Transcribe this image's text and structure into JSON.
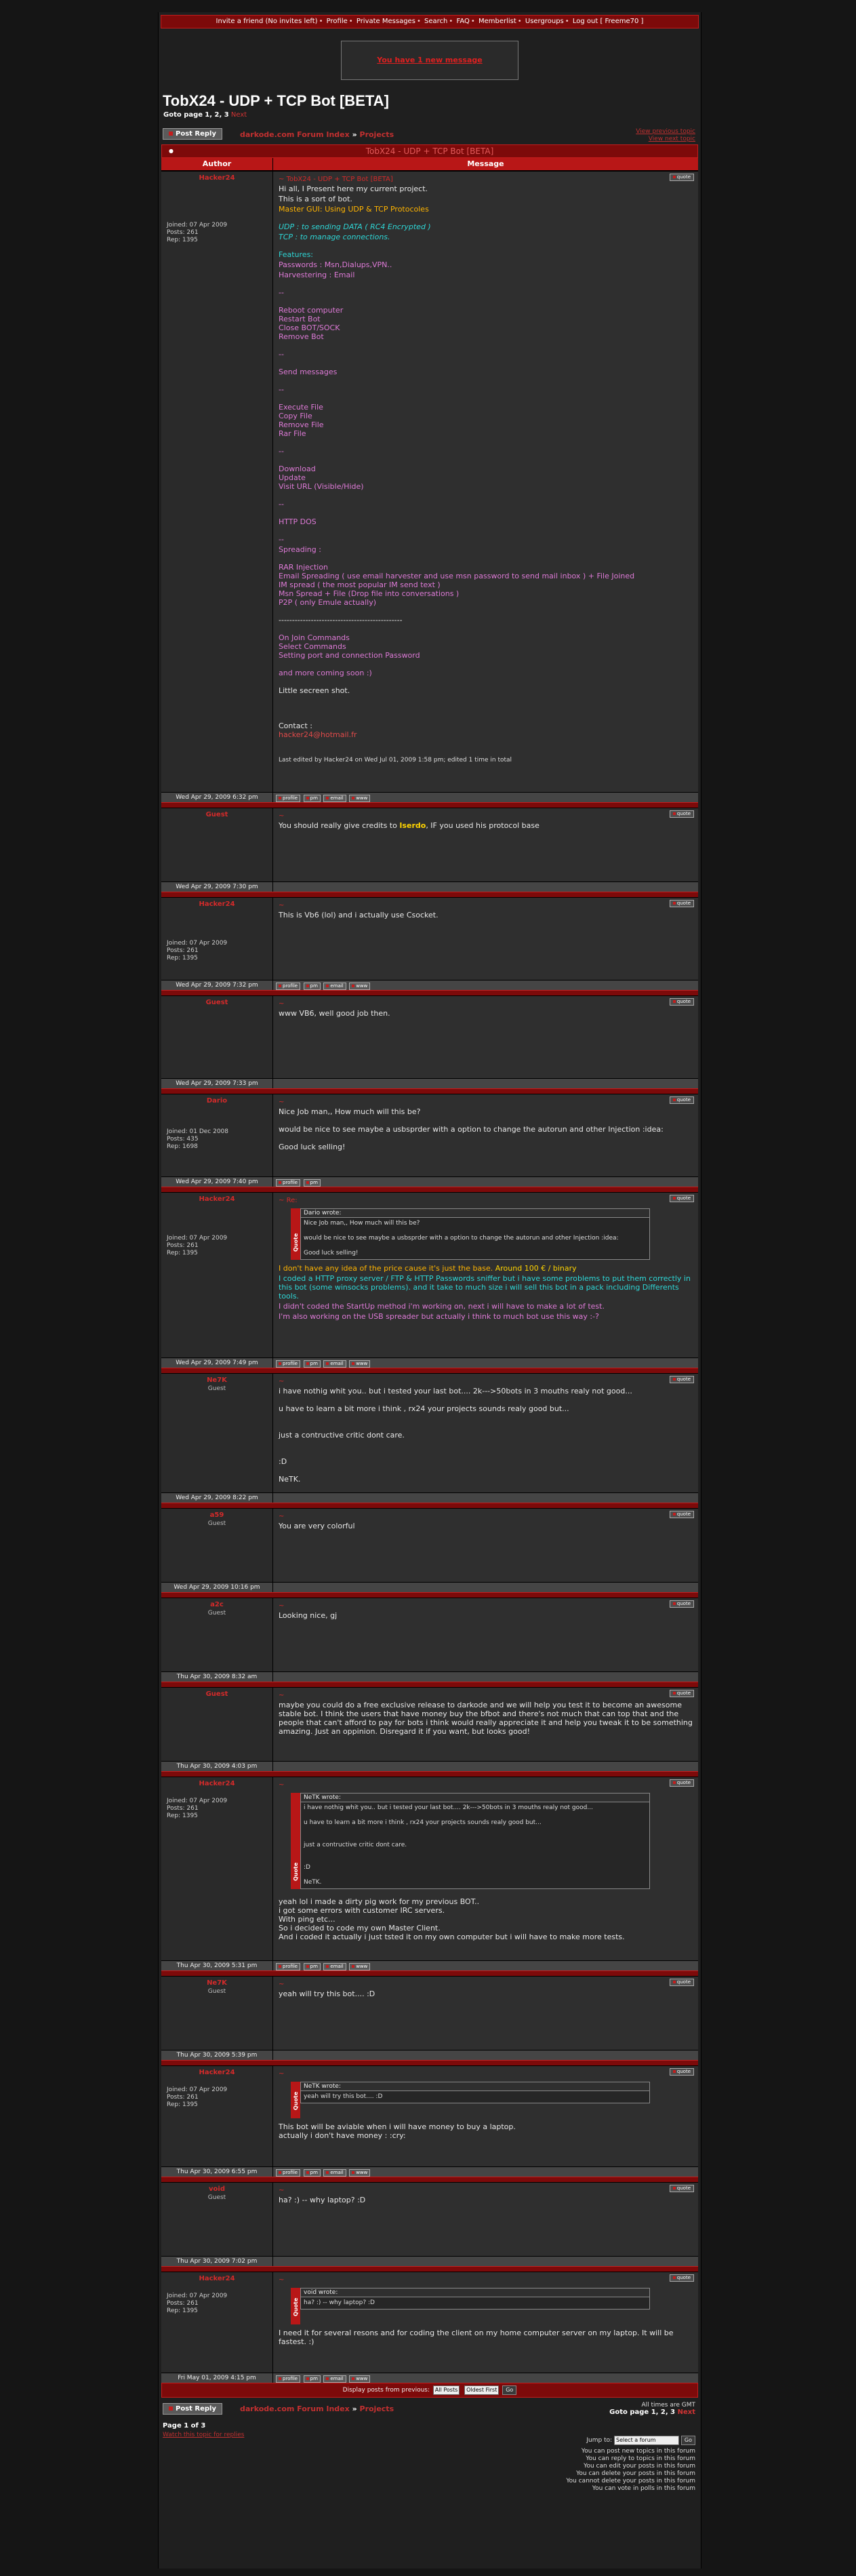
{
  "topnav": {
    "items": [
      "Invite a friend (No invites left)",
      "Profile",
      "Private Messages",
      "Search",
      "FAQ",
      "Memberlist",
      "Usergroups",
      "Log out [ Freeme70 ]"
    ]
  },
  "pm_notice": "You have 1 new message",
  "thread": {
    "title": "TobX24 - UDP + TCP Bot [BETA]",
    "goto_label": "Goto page",
    "goto_pages": "1, 2, 3",
    "goto_next": "Next",
    "post_reply": "Post Reply",
    "crumb_forum_index": "darkode.com Forum Index",
    "crumb_arrow": "»",
    "crumb_projects": "Projects",
    "view_prev": "View previous topic",
    "view_next": "View next topic",
    "table_title": "TobX24 - UDP + TCP Bot [BETA]",
    "col_author": "Author",
    "col_message": "Message"
  },
  "buttons": {
    "quote": "quote",
    "profile": "profile",
    "pm": "pm",
    "email": "email",
    "www": "www"
  },
  "posts": {
    "p1": {
      "author": "Hacker24",
      "joined": "Joined: 07 Apr 2009",
      "posts": "Posts: 261",
      "rep": "Rep: 1395",
      "subject": "TobX24 - UDP + TCP Bot [BETA]",
      "date": "Wed Apr 29, 2009 6:32 pm",
      "edit": "Last edited by Hacker24 on Wed Jul 01, 2009 1:58 pm; edited 1 time in total",
      "l1": "Hi all, I Present here my current project.",
      "l2": "This is a sort of bot.",
      "l3": "Master GUI: Using UDP & TCP Protocoles",
      "l4": "UDP : to sending DATA ( RC4 Encrypted )",
      "l5": "TCP : to manage connections.",
      "l6": "Features:",
      "l7": "Passwords : Msn,Dialups,VPN..",
      "l8": "Harvestering : Email",
      "d": "--",
      "l9": "Reboot computer\nRestart Bot\nClose BOT/SOCK\nRemove Bot",
      "l10": "Send messages",
      "l11": "Execute File\nCopy File\nRemove File\nRar File",
      "l12": "Download\nUpdate\nVisit URL (Visible/Hide)",
      "l13": "HTTP DOS",
      "l14": "Spreading :",
      "l15": "RAR Injection\nEmail Spreading ( use email harvester and use msn password to send mail inbox ) + File Joined\nIM spread ( the most popular IM send text )\nMsn Spread + File (Drop file into conversations )\nP2P ( only Emule actually)",
      "l16": "----------------------------------------------",
      "l17": "On Join Commands\nSelect Commands\nSetting port and connection Password",
      "l18": "and more coming soon :)",
      "l19": "Little secreen shot.",
      "contact_label": "Contact :",
      "contact": "hacker24@hotmail.fr"
    },
    "p2": {
      "author": "Guest",
      "date": "Wed Apr 29, 2009 7:30 pm",
      "t1": "You should really give credits to ",
      "t2": "Iserdo",
      "t3": ", IF you used his protocol base"
    },
    "p3": {
      "author": "Hacker24",
      "joined": "Joined: 07 Apr 2009",
      "posts": "Posts: 261",
      "rep": "Rep: 1395",
      "date": "Wed Apr 29, 2009 7:32 pm",
      "t": "This is Vb6 (lol) and i actually use Csocket."
    },
    "p4": {
      "author": "Guest",
      "date": "Wed Apr 29, 2009 7:33 pm",
      "t": "www VB6, well good job then."
    },
    "p5": {
      "author": "Dario",
      "joined": "Joined: 01 Dec 2008",
      "posts": "Posts: 435",
      "rep": "Rep: 1698",
      "date": "Wed Apr 29, 2009 7:40 pm",
      "t": "Nice Job man,, How much will this be?\n\nwould be nice to see maybe a usbsprder with a option to change the autorun and other Injection :idea:\n\nGood luck selling!"
    },
    "p6": {
      "author": "Hacker24",
      "joined": "Joined: 07 Apr 2009",
      "posts": "Posts: 261",
      "rep": "Rep: 1395",
      "date": "Wed Apr 29, 2009 7:49 pm",
      "subject": "Re:",
      "q_who": "Dario wrote:",
      "q_text": "Nice Job man,, How much will this be?\n\nwould be nice to see maybe a usbsprder with a option to change the autorun and other Injection :idea:\n\nGood luck selling!",
      "t1": "I don't have any idea of the price cause it's just the base. ",
      "t1b": "Around 100 € / binary",
      "t2": "I coded a HTTP proxy server / FTP & HTTP Passwords sniffer but i have some problems to put them correctly in this bot (some winsocks problems). and it take to much size i will sell this bot in a pack including Differents tools.",
      "t3": "I didn't coded the StartUp method i'm working on, next i will have to make a lot of test.",
      "t4": "I'm also working on the USB spreader but actually i think to much bot use this way :-?"
    },
    "p7": {
      "author": "Ne7K",
      "rank": "Guest",
      "date": "Wed Apr 29, 2009 8:22 pm",
      "t": "i have nothig whit you.. but i tested your last bot.... 2k--->50bots in 3 mouths realy not good...\n\nu have to learn a bit more i think , rx24 your projects sounds realy good but...\n\n\njust a contructive critic dont care.\n\n\n:D\n\nNeTK."
    },
    "p8": {
      "author": "a59",
      "rank": "Guest",
      "date": "Wed Apr 29, 2009 10:16 pm",
      "t": "You are very colorful"
    },
    "p9": {
      "author": "a2c",
      "rank": "Guest",
      "date": "Thu Apr 30, 2009 8:32 am",
      "t": "Looking nice, gj"
    },
    "p10": {
      "author": "Guest",
      "date": "Thu Apr 30, 2009 4:03 pm",
      "t": "maybe you could do a free exclusive release to darkode and we will help you test it to become an awesome stable bot. I think the users that have money buy the bfbot and there's not much that can top that and the people that can't afford to pay for bots i think would really appreciate it and help you tweak it to be something amazing. Just an oppinion. Disregard it if you want, but looks good!"
    },
    "p11": {
      "author": "Hacker24",
      "joined": "Joined: 07 Apr 2009",
      "posts": "Posts: 261",
      "rep": "Rep: 1395",
      "date": "Thu Apr 30, 2009 5:31 pm",
      "q_who": "NeTK wrote:",
      "q_text": "i have nothig whit you.. but i tested your last bot.... 2k--->50bots in 3 mouths realy not good...\n\nu have to learn a bit more i think , rx24 your projects sounds realy good but...\n\n\njust a contructive critic dont care.\n\n\n:D\n\nNeTK.",
      "t": "yeah lol i made a dirty pig work for my previous BOT..\ni got some errors with customer IRC servers.\nWith ping etc...\nSo i decided to code my own Master Client.\nAnd i coded it actually i just tsted it on my own computer but i will have to make more tests."
    },
    "p12": {
      "author": "Ne7K",
      "rank": "Guest",
      "date": "Thu Apr 30, 2009 5:39 pm",
      "t": "yeah will try this bot.... :D"
    },
    "p13": {
      "author": "Hacker24",
      "joined": "Joined: 07 Apr 2009",
      "posts": "Posts: 261",
      "rep": "Rep: 1395",
      "date": "Thu Apr 30, 2009 6:55 pm",
      "q_who": "NeTK wrote:",
      "q_text": "yeah will try this bot.... :D",
      "t": "This bot will be aviable when i will have money to buy a laptop.\nactually i don't have money : :cry:"
    },
    "p14": {
      "author": "void",
      "rank": "Guest",
      "date": "Thu Apr 30, 2009 7:02 pm",
      "t": "ha? :) -- why laptop? :D"
    },
    "p15": {
      "author": "Hacker24",
      "joined": "Joined: 07 Apr 2009",
      "posts": "Posts: 261",
      "rep": "Rep: 1395",
      "date": "Fri May 01, 2009 4:15 pm",
      "q_who": "void wrote:",
      "q_text": "ha? :) -- why laptop? :D",
      "t": "I need it for several resons and for coding the client on my home computer server on my laptop. It will be fastest. :)"
    }
  },
  "footer": {
    "display_label": "Display posts from previous:",
    "all_posts": "All Posts",
    "oldest_first": "Oldest First",
    "go": "Go",
    "post_reply": "Post Reply",
    "crumb_forum_index": "darkode.com Forum Index",
    "crumb_projects": "Projects",
    "timezone": "All times are GMT",
    "goto_label": "Goto page",
    "goto_pages": "1, 2, 3",
    "goto_next": "Next",
    "page_of": "Page 1 of 3",
    "watch": "Watch this topic for replies",
    "jump_label": "Jump to:",
    "jump_select": "Select a forum",
    "jump_go": "Go",
    "perm1": "You can post new topics in this forum",
    "perm2": "You can reply to topics in this forum",
    "perm3": "You can edit your posts in this forum",
    "perm4": "You can delete your posts in this forum",
    "perm5": "You cannot delete your posts in this forum",
    "perm6": "You can vote in polls in this forum"
  }
}
